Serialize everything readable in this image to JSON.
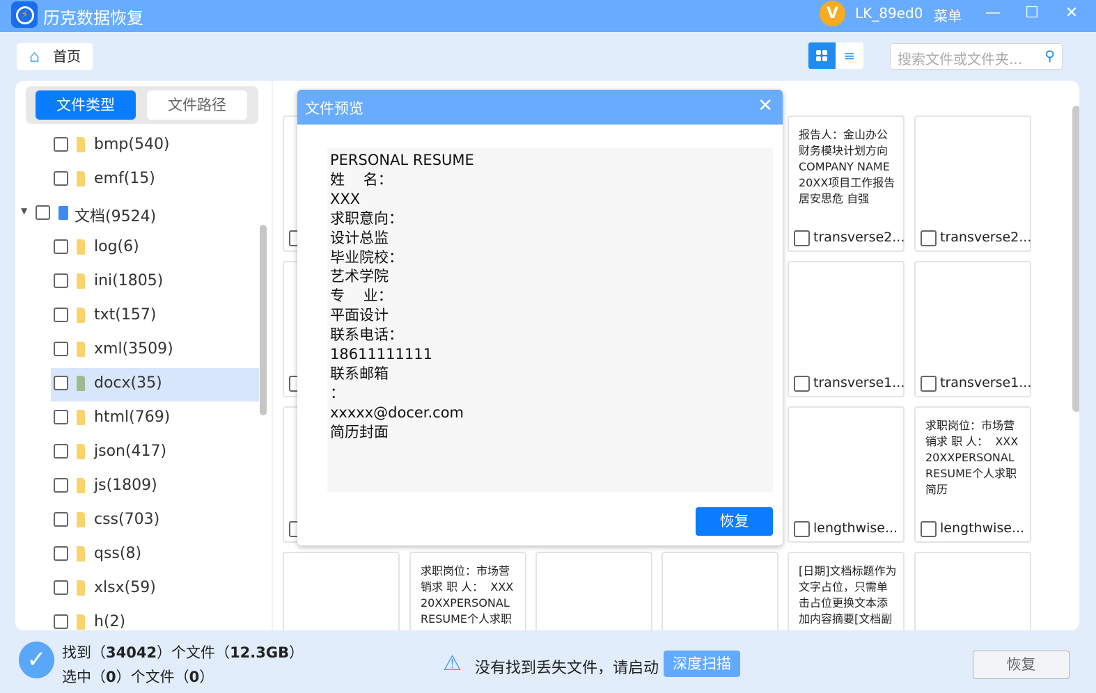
{
  "app": {
    "title": "历克数据恢复",
    "avatar_letter": "V",
    "username": "LK_89ed0",
    "menu": "菜单",
    "brand_color": "#68acff",
    "accent": "#0a7cff"
  },
  "toolbar": {
    "home": "首页",
    "search_placeholder": "搜索文件或文件夹...",
    "view_mode": "grid"
  },
  "tabs": {
    "file_type": "文件类型",
    "file_path": "文件路径",
    "active": "file_type"
  },
  "tree": [
    {
      "label": "bmp(540)",
      "level": 2
    },
    {
      "label": "emf(15)",
      "level": 2
    },
    {
      "label": "文档(9524)",
      "level": 1,
      "expanded": true
    },
    {
      "label": "log(6)",
      "level": 2
    },
    {
      "label": "ini(1805)",
      "level": 2
    },
    {
      "label": "txt(157)",
      "level": 2
    },
    {
      "label": "xml(3509)",
      "level": 2
    },
    {
      "label": "docx(35)",
      "level": 2,
      "selected": true
    },
    {
      "label": "html(769)",
      "level": 2
    },
    {
      "label": "json(417)",
      "level": 2
    },
    {
      "label": "js(1809)",
      "level": 2
    },
    {
      "label": "css(703)",
      "level": 2
    },
    {
      "label": "qss(8)",
      "level": 2
    },
    {
      "label": "xlsx(59)",
      "level": 2
    },
    {
      "label": "h(2)",
      "level": 2
    }
  ],
  "cards": [
    {
      "text": "报告人：金山办公\n财务模块计划方向\nCOMPANY NAME\n20XX项目工作报告\n居安思危 自强",
      "name": "transverse2..."
    },
    {
      "text": "",
      "name": "transverse2..."
    },
    {
      "text": "",
      "name": "transverse1..."
    },
    {
      "text": "",
      "name": "transverse1..."
    },
    {
      "text": "",
      "name": "lengthwise..."
    },
    {
      "text": "求职岗位：市场营\n销求 职 人：  XXX\n20XXPERSONAL\nRESUME个人求职\n简历",
      "name": "lengthwise..."
    },
    {
      "text": "",
      "name": ""
    },
    {
      "text": "求职岗位：市场营\n销求 职 人：  XXX\n20XXPERSONAL\nRESUME个人求职",
      "name": ""
    },
    {
      "text": "",
      "name": ""
    },
    {
      "text": "",
      "name": ""
    },
    {
      "text": "[日期]文档标题作为\n文字占位，只需单\n击占位更换文本添\n加内容摘要[文档副",
      "name": ""
    },
    {
      "text": "",
      "name": ""
    }
  ],
  "modal": {
    "title": "文件预览",
    "lines": [
      "PERSONAL RESUME",
      "姓    名：",
      "XXX",
      "求职意向：",
      "设计总监",
      "毕业院校：",
      "艺术学院",
      "专    业：",
      "平面设计",
      "联系电话：",
      "18611111111",
      "联系邮箱",
      "：",
      "xxxxx@docer.com",
      "简历封面"
    ],
    "recover": "恢复"
  },
  "status": {
    "found_prefix": "找到（",
    "found_count": "34042",
    "found_mid": "）个文件（",
    "found_size": "12.3GB",
    "found_suffix": "）",
    "sel_prefix": "选中（",
    "sel_count": "0",
    "sel_mid": "）个文件（",
    "sel_size": "0",
    "sel_suffix": "）",
    "warning": "没有找到丢失文件，请启动",
    "deep_scan": "深度扫描",
    "recover": "恢复"
  }
}
